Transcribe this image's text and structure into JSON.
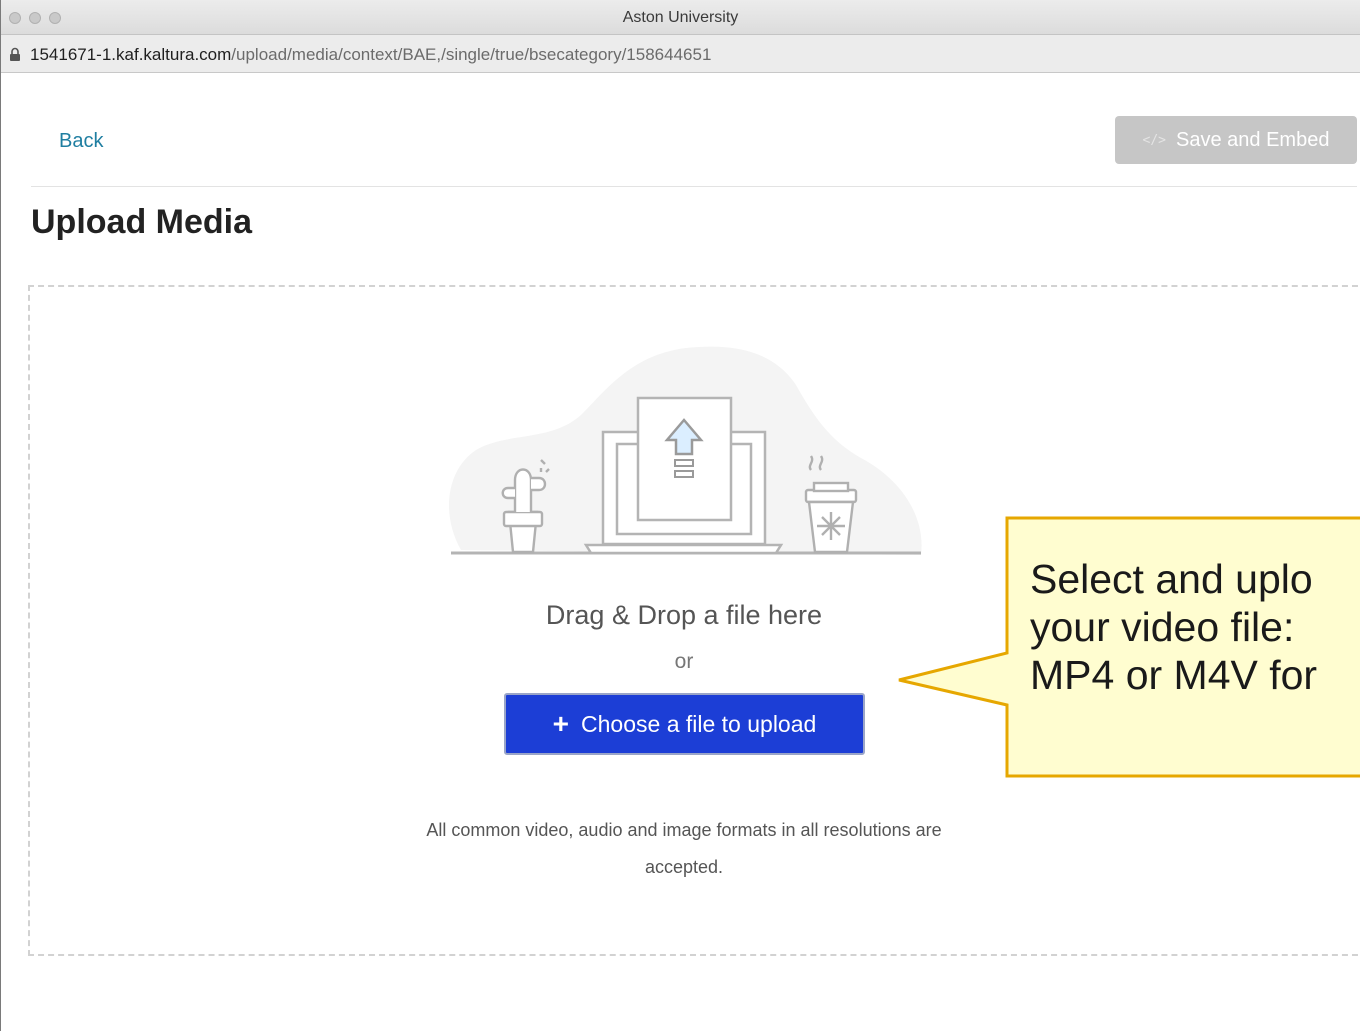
{
  "window": {
    "title": "Aston University"
  },
  "address_bar": {
    "host": "1541671-1.kaf.kaltura.com",
    "path": "/upload/media/context/BAE,/single/true/bsecategory/158644651"
  },
  "header": {
    "back_label": "Back",
    "save_label": "Save and Embed",
    "save_icon": "</>"
  },
  "page": {
    "title": "Upload Media"
  },
  "dropzone": {
    "drag_text": "Drag & Drop a file here",
    "or_text": "or",
    "choose_label": "Choose a file to upload",
    "plus_icon": "+",
    "formats_line1": "All common video, audio and image formats in all resolutions are",
    "formats_line2": "accepted."
  },
  "callout": {
    "line1": "Select and uplo",
    "line2": "your video file:",
    "line3": "MP4 or M4V for"
  },
  "colors": {
    "accent_blue": "#1c3ed6",
    "link_teal": "#1f7ea1",
    "callout_border": "#e6a700",
    "callout_fill": "#fffdd0"
  }
}
